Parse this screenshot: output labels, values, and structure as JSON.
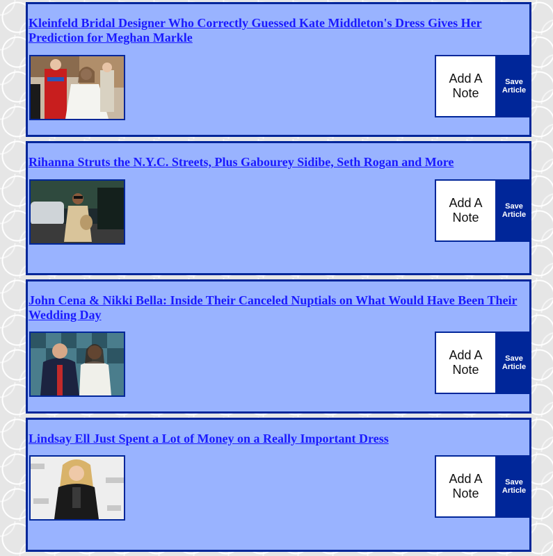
{
  "articles": [
    {
      "title": "Kleinfeld Bridal Designer Who Correctly Guessed Kate Middleton's Dress Gives Her Prediction for Meghan Markle",
      "note_label": "Add A Note",
      "save_label": "Save Article"
    },
    {
      "title": "Rihanna Struts the N.Y.C. Streets, Plus Gabourey Sidibe, Seth Rogan and More",
      "note_label": "Add A Note",
      "save_label": "Save Article"
    },
    {
      "title": "John Cena & Nikki Bella: Inside Their Canceled Nuptials on What Would Have Been Their Wedding Day",
      "note_label": "Add A Note",
      "save_label": "Save Article"
    },
    {
      "title": "Lindsay Ell Just Spent a Lot of Money on a Really Important Dress ",
      "note_label": "Add A Note",
      "save_label": "Save Article"
    }
  ],
  "colors": {
    "card_background": "#99b3ff",
    "card_border": "#002699",
    "link": "#1a1aff",
    "save_button": "#002699"
  }
}
